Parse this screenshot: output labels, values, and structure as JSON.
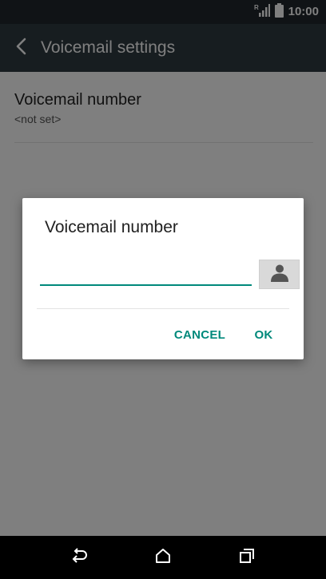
{
  "status_bar": {
    "time": "10:00",
    "icons": [
      "signal-icon",
      "battery-icon"
    ]
  },
  "app_bar": {
    "title": "Voicemail settings",
    "back_icon": "chevron-left-icon"
  },
  "settings": {
    "voicemail_number": {
      "title": "Voicemail number",
      "summary": "<not set>"
    }
  },
  "dialog": {
    "title": "Voicemail number",
    "input_value": "",
    "contact_icon": "contact-person-icon",
    "cancel_label": "CANCEL",
    "ok_label": "OK"
  },
  "nav_bar": {
    "icons": [
      "back-arrow-icon",
      "home-icon",
      "recents-icon"
    ]
  },
  "colors": {
    "accent": "#00897b",
    "app_bar": "#2f3a40",
    "status_bar": "#20272c",
    "nav_bar": "#000000"
  }
}
